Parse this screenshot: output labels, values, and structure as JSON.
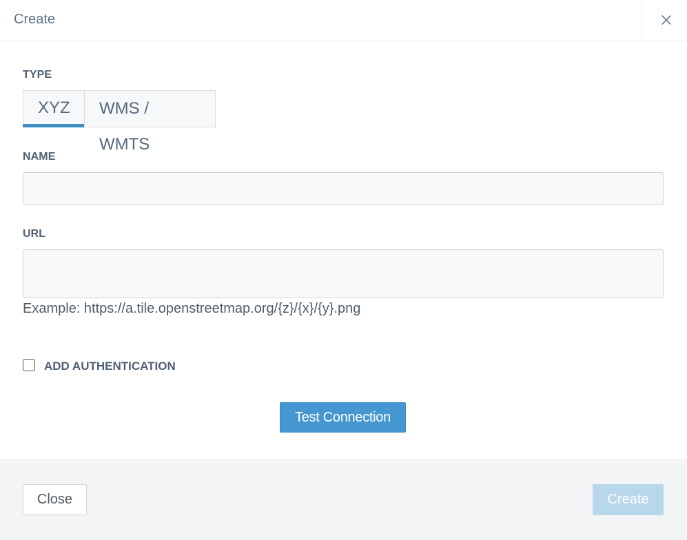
{
  "header": {
    "title": "Create",
    "close_icon": "close-icon"
  },
  "type_section": {
    "label": "TYPE",
    "tabs": [
      {
        "label": "XYZ",
        "selected": true
      },
      {
        "label": "WMS / WMTS",
        "selected": false
      }
    ]
  },
  "name_section": {
    "label": "NAME",
    "value": "",
    "placeholder": ""
  },
  "url_section": {
    "label": "URL",
    "value": "",
    "placeholder": "",
    "hint": "Example: https://a.tile.openstreetmap.org/{z}/{x}/{y}.png"
  },
  "auth": {
    "label": "ADD AUTHENTICATION",
    "checked": false
  },
  "test_button": {
    "label": "Test Connection"
  },
  "footer": {
    "close_label": "Close",
    "create_label": "Create"
  },
  "colors": {
    "accent": "#4497d0",
    "tab_indicator": "#3f8fc3",
    "create_disabled": "#b8d7eb",
    "footer_bg": "#f3f4f6"
  }
}
